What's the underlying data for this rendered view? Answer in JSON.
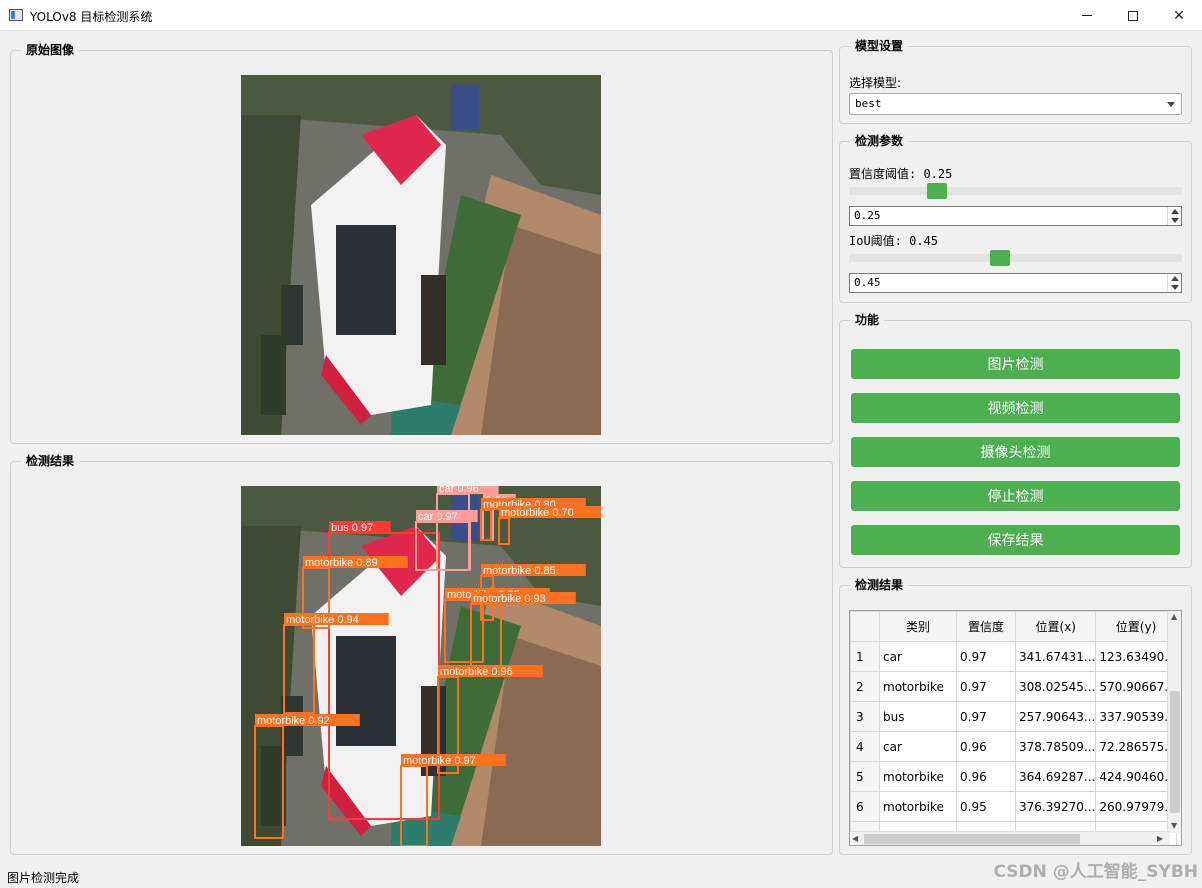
{
  "window": {
    "title": "YOLOv8 目标检测系统"
  },
  "original_group": {
    "title": "原始图像"
  },
  "result_group": {
    "title": "检测结果"
  },
  "model_group": {
    "title": "模型设置",
    "select_label": "选择模型:",
    "selected_model": "best"
  },
  "params_group": {
    "title": "检测参数",
    "conf_label": "置信度阈值: 0.25",
    "conf_value": "0.25",
    "conf_level": 0.25,
    "iou_label": "IoU阈值: 0.45",
    "iou_value": "0.45",
    "iou_level": 0.45
  },
  "function_group": {
    "title": "功能",
    "buttons": [
      "图片检测",
      "视频检测",
      "摄像头检测",
      "停止检测",
      "保存结果"
    ]
  },
  "results_table_group": {
    "title": "检测结果",
    "headers": [
      "类别",
      "置信度",
      "位置(x)",
      "位置(y)"
    ],
    "rows": [
      {
        "num": "1",
        "cls": "car",
        "conf": "0.97",
        "x": "341.67431...",
        "y": "123.63490..."
      },
      {
        "num": "2",
        "cls": "motorbike",
        "conf": "0.97",
        "x": "308.02545...",
        "y": "570.90667..."
      },
      {
        "num": "3",
        "cls": "bus",
        "conf": "0.97",
        "x": "257.90643...",
        "y": "337.90539..."
      },
      {
        "num": "4",
        "cls": "car",
        "conf": "0.96",
        "x": "378.78509...",
        "y": "72.286575..."
      },
      {
        "num": "5",
        "cls": "motorbike",
        "conf": "0.96",
        "x": "364.69287...",
        "y": "424.90460..."
      },
      {
        "num": "6",
        "cls": "motorbike",
        "conf": "0.95",
        "x": "376.39270...",
        "y": "260.97979..."
      },
      {
        "num": "",
        "cls": "",
        "conf": "",
        "x": "",
        "y": ""
      }
    ]
  },
  "detections": [
    {
      "label": "bus 0.97",
      "color": "#ff3838"
    },
    {
      "label": "car 0.97",
      "color": "#ff9d97"
    },
    {
      "label": "car 0.96",
      "color": "#ff9d97"
    },
    {
      "label": "0.86",
      "color": "#ff9d97"
    },
    {
      "label": "motorbike 0.80",
      "color": "#ff701f"
    },
    {
      "label": "motorbike 0.70",
      "color": "#ff701f"
    },
    {
      "label": "motorbike 0.89",
      "color": "#ff701f"
    },
    {
      "label": "motorbike 0.85",
      "color": "#ff701f"
    },
    {
      "label": "motorbike 0.95",
      "color": "#ff701f"
    },
    {
      "label": "motorbike 0.93",
      "color": "#ff701f"
    },
    {
      "label": "motorbike 0.94",
      "color": "#ff701f"
    },
    {
      "label": "motorbike 0.96",
      "color": "#ff701f"
    },
    {
      "label": "motorbike 0.92",
      "color": "#ff701f"
    },
    {
      "label": "motorbike 0.97",
      "color": "#ff701f"
    }
  ],
  "status": "图片检测完成",
  "watermark": "CSDN @人工智能_SYBH"
}
